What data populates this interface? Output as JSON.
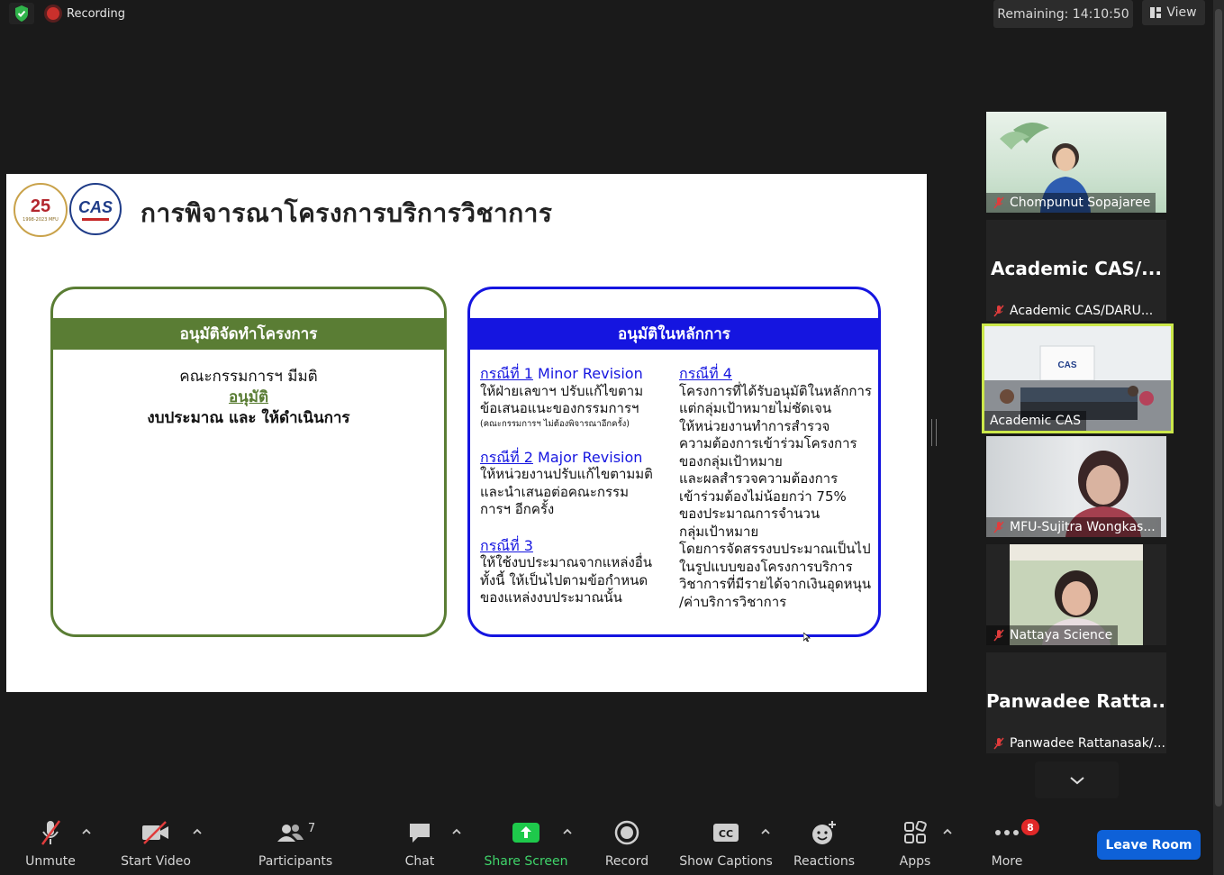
{
  "topbar": {
    "recording_label": "Recording",
    "remaining_label": "Remaining: 14:10:50",
    "view_label": "View"
  },
  "slide": {
    "logo_left_text": "25",
    "logo_left_subtext": "1998-2023 MFU",
    "logo_right_text": "CAS",
    "title": "การพิจารณาโครงการบริการวิชาการ",
    "left_box": {
      "header": "อนุมัติจัดทำโครงการ",
      "line1": "คณะกรรมการฯ มีมติ",
      "line2": "อนุมัติ",
      "line3": "งบประมาณ และ ให้ดำเนินการ"
    },
    "right_box": {
      "header": "อนุมัติในหลักการ",
      "case1_label": "กรณีที่ 1",
      "case1_title": " Minor Revision",
      "case1_l1": "ให้ฝ่ายเลขาฯ ปรับแก้ไขตาม",
      "case1_l2": "ข้อเสนอแนะของกรรมการฯ",
      "case1_note": "(คณะกรรมการฯ ไม่ต้องพิจารณาอีกครั้ง)",
      "case2_label": "กรณีที่ 2",
      "case2_title": " Major Revision",
      "case2_l1": "ให้หน่วยงานปรับแก้ไขตามมติ",
      "case2_l2": "และนำเสนอต่อคณะกรรม",
      "case2_l3": "การฯ อีกครั้ง",
      "case3_label": "กรณีที่ 3",
      "case3_l1": "ให้ใช้งบประมาณจากแหล่งอื่น",
      "case3_l2": "ทั้งนี้ ให้เป็นไปตามข้อกำหนด",
      "case3_l3": "ของแหล่งงบประมาณนั้น",
      "case4_label": "กรณีที่ 4",
      "case4_lines": [
        "โครงการที่ได้รับอนุมัติในหลักการ",
        "แต่กลุ่มเป้าหมายไม่ชัดเจน",
        "ให้หน่วยงานทำการสำรวจ",
        "ความต้องการเข้าร่วมโครงการ",
        "ของกลุ่มเป้าหมาย",
        "และผลสำรวจความต้องการ",
        "เข้าร่วมต้องไม่น้อยกว่า 75%",
        "ของประมาณการจำนวน",
        "กลุ่มเป้าหมาย",
        "โดยการจัดสรรงบประมาณเป็นไป",
        "ในรูปแบบของโครงการบริการ",
        "วิชาการที่มีรายได้จากเงินอุดหนุน",
        "/ค่าบริการวิชาการ"
      ]
    }
  },
  "participants": [
    {
      "name": "Chompunut Sopajaree",
      "big": ""
    },
    {
      "name": "Academic CAS/DARU...",
      "big": "Academic  CAS/..."
    },
    {
      "name": "Academic CAS",
      "big": ""
    },
    {
      "name": "MFU-Sujitra Wongkas...",
      "big": ""
    },
    {
      "name": "Nattaya Science",
      "big": ""
    },
    {
      "name": "Panwadee Rattanasak/...",
      "big": "Panwadee  Ratta..."
    }
  ],
  "toolbar": {
    "unmute": "Unmute",
    "start_video": "Start Video",
    "participants": "Participants",
    "participants_count": "7",
    "chat": "Chat",
    "share_screen": "Share Screen",
    "record": "Record",
    "show_captions": "Show Captions",
    "reactions": "Reactions",
    "apps": "Apps",
    "more": "More",
    "more_badge": "8",
    "leave": "Leave Room"
  },
  "colors": {
    "approve_green": "#5a7d34",
    "principle_blue": "#1515e0",
    "share_green": "#1ec94b",
    "leave_blue": "#0e61d8",
    "active_speaker": "#cce84a"
  }
}
